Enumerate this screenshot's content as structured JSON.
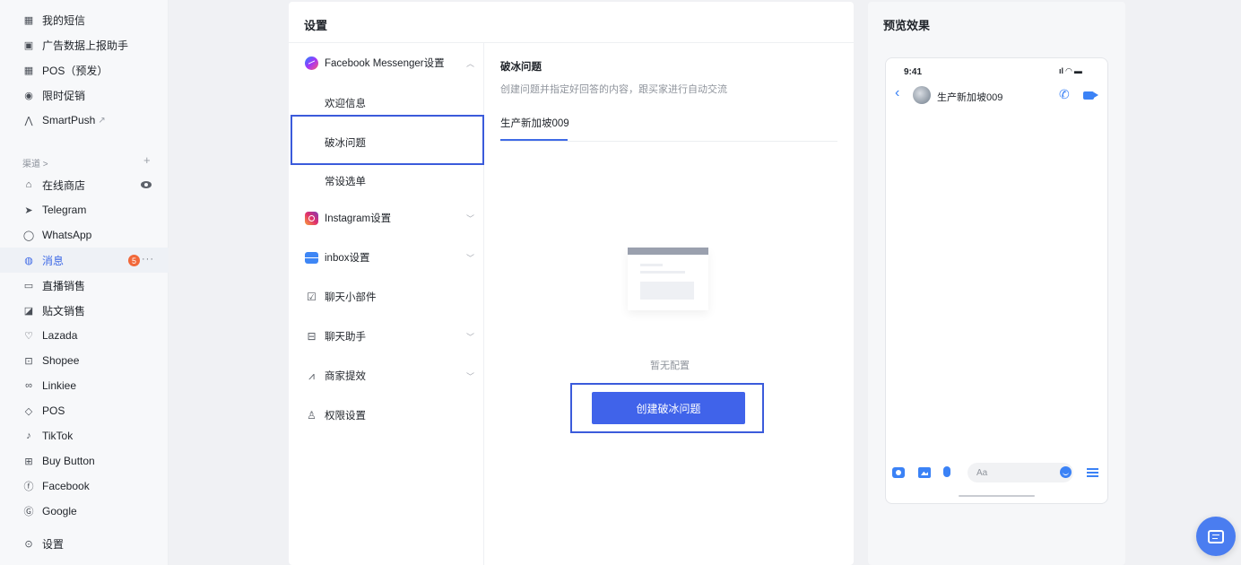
{
  "sidebar": {
    "top_items": [
      {
        "label": "我的短信",
        "icon": "grid-icon"
      },
      {
        "label": "广告数据上报助手",
        "icon": "ad-data-icon"
      },
      {
        "label": "POS（预发）",
        "icon": "grid-icon"
      },
      {
        "label": "限时促销",
        "icon": "timer-icon"
      },
      {
        "label": "SmartPush",
        "icon": "smartpush-icon"
      }
    ],
    "channels_label": "渠道 >",
    "channel_items": [
      {
        "label": "在线商店",
        "icon": "store-icon"
      },
      {
        "label": "Telegram",
        "icon": "telegram-icon"
      },
      {
        "label": "WhatsApp",
        "icon": "whatsapp-icon"
      },
      {
        "label": "消息",
        "icon": "message-icon",
        "badge": "5"
      },
      {
        "label": "直播销售",
        "icon": "live-icon"
      },
      {
        "label": "贴文销售",
        "icon": "post-icon"
      },
      {
        "label": "Lazada",
        "icon": "lazada-icon"
      },
      {
        "label": "Shopee",
        "icon": "shopee-icon"
      },
      {
        "label": "Linkiee",
        "icon": "link-icon"
      },
      {
        "label": "POS",
        "icon": "pos-icon"
      },
      {
        "label": "TikTok",
        "icon": "tiktok-icon"
      },
      {
        "label": "Buy Button",
        "icon": "buy-button-icon"
      },
      {
        "label": "Facebook",
        "icon": "facebook-icon"
      },
      {
        "label": "Google",
        "icon": "google-icon"
      }
    ],
    "settings_label": "设置"
  },
  "settings": {
    "title": "设置",
    "menu": {
      "facebook_messenger": "Facebook Messenger设置",
      "welcome": "欢迎信息",
      "icebreaker": "破冰问题",
      "persistent_menu": "常设选单",
      "instagram": "Instagram设置",
      "inbox": "inbox设置",
      "chat_widget": "聊天小部件",
      "chat_assistant": "聊天助手",
      "merchant_boost": "商家提效",
      "permissions": "权限设置"
    },
    "content": {
      "title": "破冰问题",
      "description": "创建问题并指定好回答的内容，跟买家进行自动交流",
      "tab": "生产新加坡009",
      "empty_text": "暂无配置",
      "create_button": "创建破冰问题"
    }
  },
  "preview": {
    "title": "预览效果",
    "time": "9:41",
    "chat_name": "生产新加坡009",
    "input_placeholder": "Aa"
  },
  "colors": {
    "accent": "#4063ea",
    "highlight_border": "#3b5bdb",
    "badge": "#f1683a"
  }
}
